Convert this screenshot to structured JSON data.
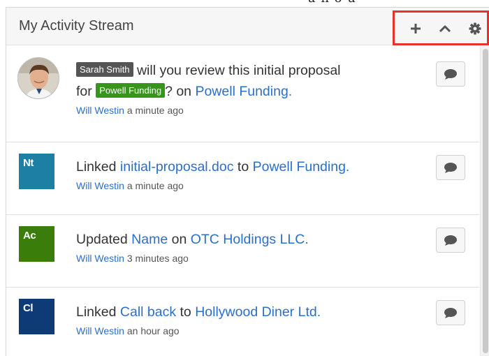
{
  "top_fragment": "u n o u",
  "dashlet": {
    "title": "My Activity Stream",
    "toolbar": {
      "add_icon": "plus-icon",
      "collapse_icon": "chevron-up-icon",
      "settings_icon": "gear-icon",
      "highlight_color": "#e8312a"
    }
  },
  "entries": [
    {
      "avatar": "photo",
      "mention": "Sarah Smith",
      "text_1": " will you review this initial proposal",
      "text_2": "for ",
      "tag": "Powell Funding",
      "text_3": "? on ",
      "record": "Powell Funding.",
      "author": "Will Westin",
      "time": " a minute ago"
    },
    {
      "badge": "Nt",
      "badge_color": "#1d7fa3",
      "action": "Linked ",
      "target": "initial-proposal.doc",
      "connector": " to ",
      "record": "Powell Funding.",
      "author": "Will Westin",
      "time": " a minute ago"
    },
    {
      "badge": "Ac",
      "badge_color": "#3a7d0a",
      "action": "Updated ",
      "target": "Name",
      "connector": " on ",
      "record": "OTC Holdings LLC.",
      "author": "Will Westin",
      "time": " 3 minutes ago"
    },
    {
      "badge": "Cl",
      "badge_color": "#0e3a75",
      "action": "Linked ",
      "target": "Call back",
      "connector": " to ",
      "record": "Hollywood Diner Ltd.",
      "author": "Will Westin",
      "time": " an hour ago"
    }
  ],
  "reply_icon": "comment-icon"
}
